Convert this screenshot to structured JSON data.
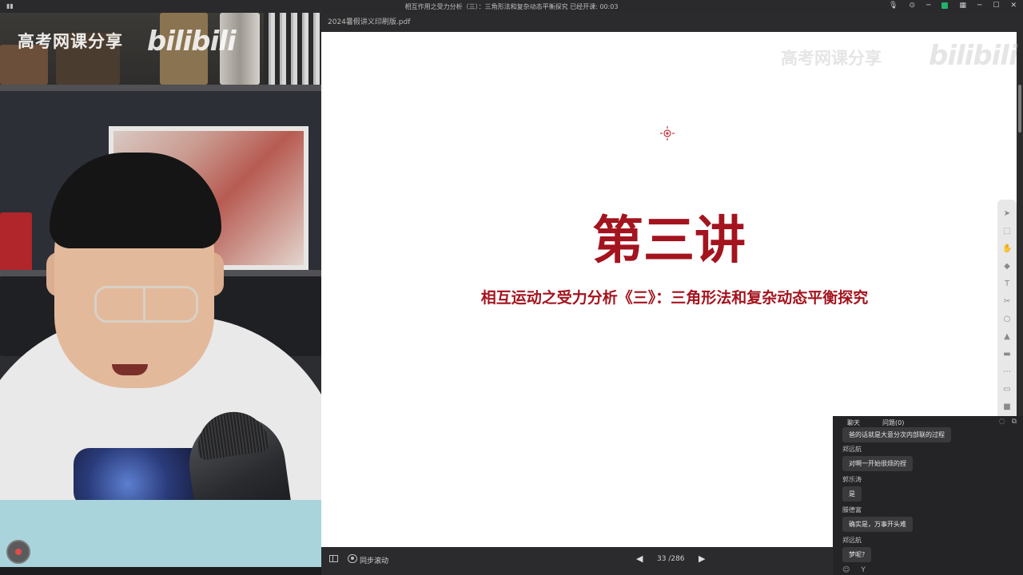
{
  "topbar": {
    "meeting_title": "相互作用之受力分析（三）：三角形法和复杂动态平衡探究   已经开课: 00:03"
  },
  "webcam": {
    "watermark_text": "高考网课分享",
    "watermark_logo": "bilibili"
  },
  "pdf": {
    "filename": "2024暑假讲义印刷版.pdf",
    "watermark_text": "高考网课分享",
    "watermark_logo": "bilibili",
    "lecture_title": "第三讲",
    "lecture_subtitle": "相互运动之受力分析《三》：三角形法和复杂动态平衡探究",
    "sync_scroll_label": "同步滚动",
    "page_indicator": "33 /286"
  },
  "chat": {
    "tabs": [
      "聊天",
      "问题(0)"
    ],
    "messages": [
      {
        "name": "",
        "text": "爸的话就是大意分次内部联的过程"
      },
      {
        "name": "郑远航",
        "text": "对啊一开始很烦的捏"
      },
      {
        "name": "郭乐涛",
        "text": "是"
      },
      {
        "name": "滕德富",
        "text": "确实是，万事开头难"
      },
      {
        "name": "郑远航",
        "text": "梦呢?"
      }
    ],
    "input_hint": "Y"
  },
  "icons": {
    "laser_pointer": "crosshair-icon",
    "toolbar": [
      "cursor-icon",
      "select-icon",
      "pointer-hand-icon",
      "eraser-icon",
      "text-icon",
      "scissors-icon",
      "circle-icon",
      "stamp-icon",
      "screen-icon",
      "lock-icon",
      "clipboard-icon",
      "video-icon"
    ]
  },
  "colors": {
    "lecture_red": "#a3141e",
    "page_bg": "#ffffff",
    "chrome_bg": "#2b2b2d"
  }
}
